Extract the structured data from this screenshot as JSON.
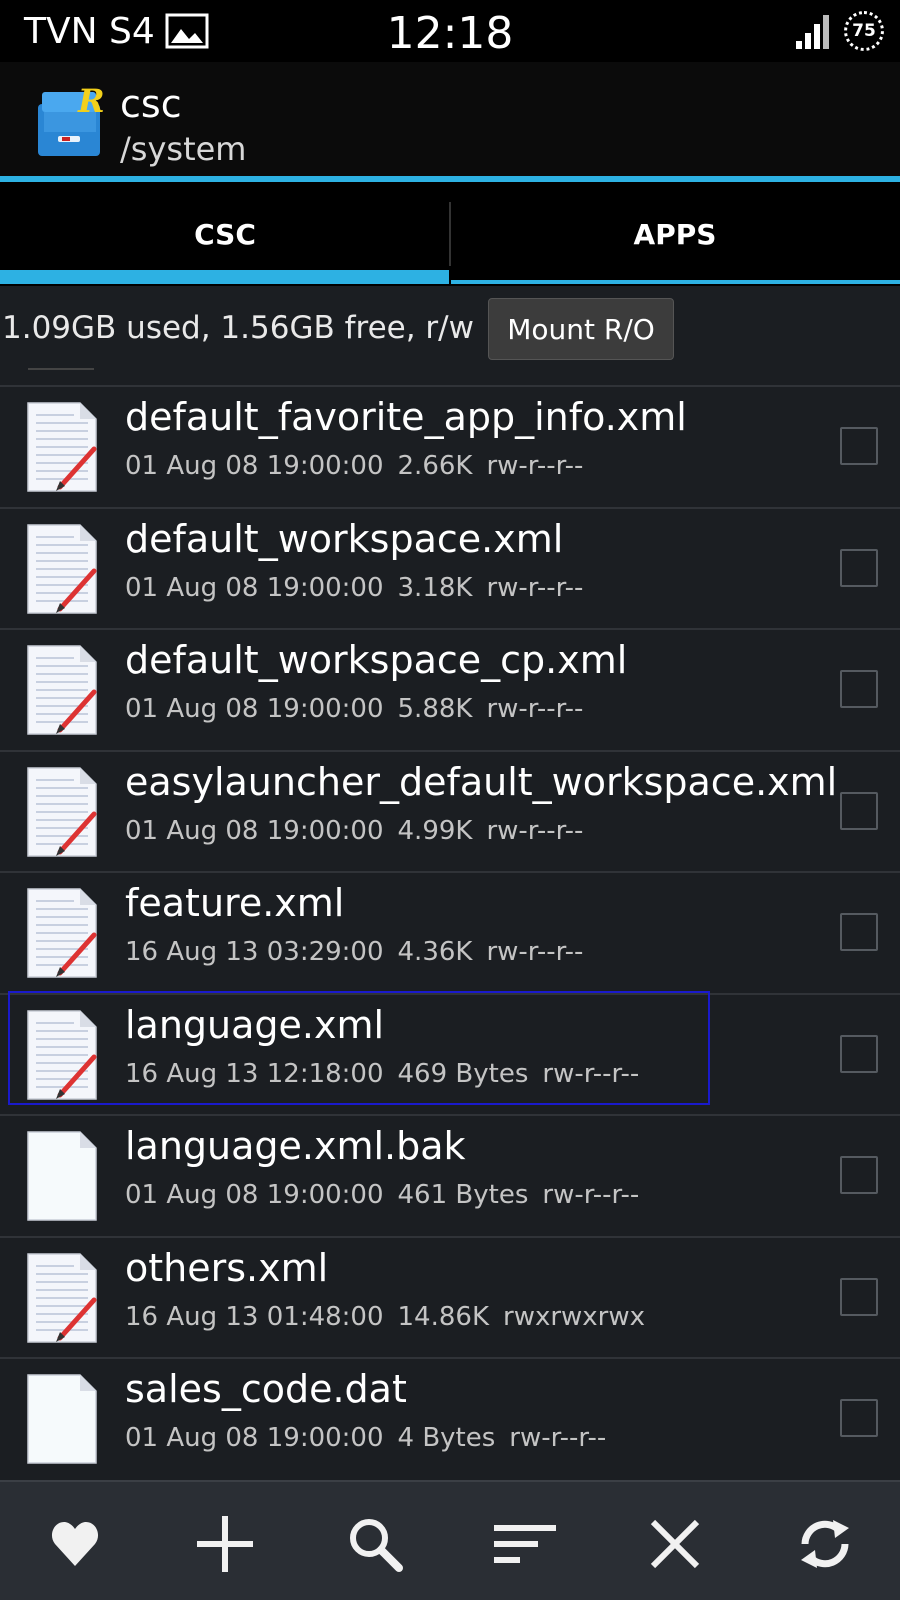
{
  "status_bar": {
    "carrier": "TVN S4",
    "time": "12:18",
    "battery": "75"
  },
  "action_bar": {
    "title": "csc",
    "subtitle": "/system"
  },
  "tabs": [
    {
      "label": "CSC",
      "active": true
    },
    {
      "label": "APPS",
      "active": false
    }
  ],
  "storage": {
    "info": "1.09GB used, 1.56GB free, r/w",
    "mount_label": "Mount R/O"
  },
  "files": [
    {
      "name": "default_favorite_app_info.xml",
      "date": "01 Aug 08 19:00:00",
      "size": "2.66K",
      "perms": "rw-r--r--",
      "icon": "xml-file-icon"
    },
    {
      "name": "default_workspace.xml",
      "date": "01 Aug 08 19:00:00",
      "size": "3.18K",
      "perms": "rw-r--r--",
      "icon": "xml-file-icon"
    },
    {
      "name": "default_workspace_cp.xml",
      "date": "01 Aug 08 19:00:00",
      "size": "5.88K",
      "perms": "rw-r--r--",
      "icon": "xml-file-icon"
    },
    {
      "name": "easylauncher_default_workspace.xml",
      "date": "01 Aug 08 19:00:00",
      "size": "4.99K",
      "perms": "rw-r--r--",
      "icon": "xml-file-icon"
    },
    {
      "name": "feature.xml",
      "date": "16 Aug 13 03:29:00",
      "size": "4.36K",
      "perms": "rw-r--r--",
      "icon": "xml-file-icon"
    },
    {
      "name": "language.xml",
      "date": "16 Aug 13 12:18:00",
      "size": "469 Bytes",
      "perms": "rw-r--r--",
      "icon": "xml-file-icon",
      "selected": true
    },
    {
      "name": "language.xml.bak",
      "date": "01 Aug 08 19:00:00",
      "size": "461 Bytes",
      "perms": "rw-r--r--",
      "icon": "blank-file-icon"
    },
    {
      "name": "others.xml",
      "date": "16 Aug 13 01:48:00",
      "size": "14.86K",
      "perms": "rwxrwxrwx",
      "icon": "xml-file-icon"
    },
    {
      "name": "sales_code.dat",
      "date": "01 Aug 08 19:00:00",
      "size": "4 Bytes",
      "perms": "rw-r--r--",
      "icon": "blank-file-icon"
    }
  ],
  "toolbar": {
    "buttons": [
      "favorite-icon",
      "add-icon",
      "search-icon",
      "sort-icon",
      "close-icon",
      "refresh-icon"
    ]
  },
  "colors": {
    "accent": "#2db1e3",
    "selection": "#1a1acc",
    "background": "#1b1e22"
  }
}
